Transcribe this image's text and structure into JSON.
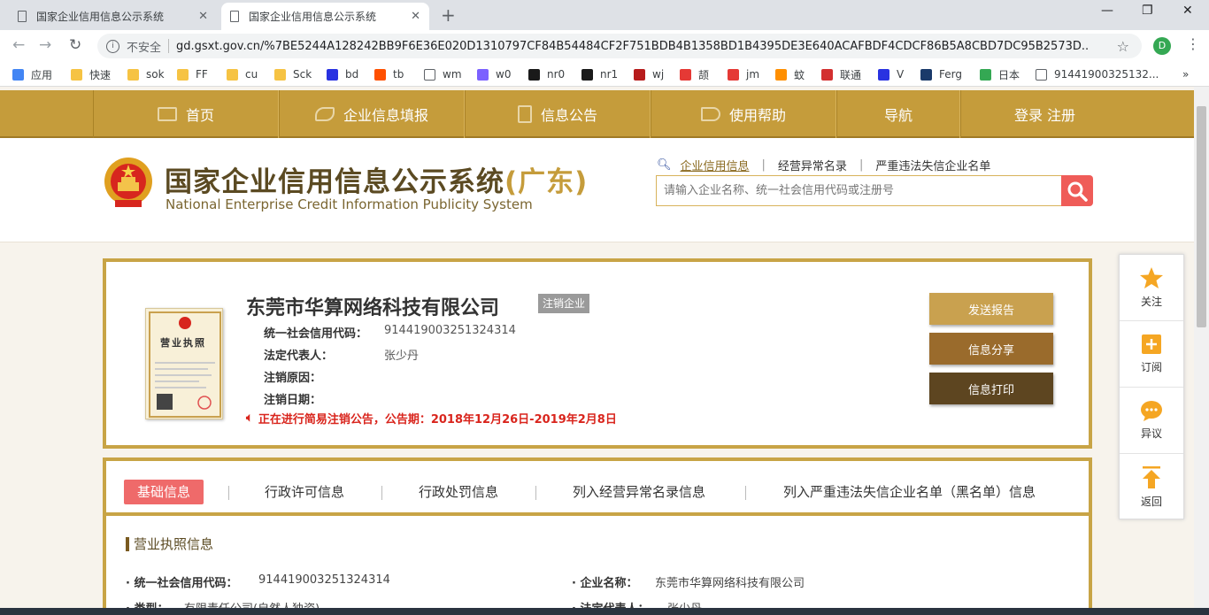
{
  "browser": {
    "tabs": [
      {
        "title": "国家企业信用信息公示系统",
        "close": "✕"
      },
      {
        "title": "国家企业信用信息公示系统",
        "close": "✕"
      }
    ],
    "new_tab": "+",
    "window_controls": {
      "minimize": "—",
      "restore": "❐",
      "close": "✕"
    },
    "nav": {
      "back": "←",
      "forward": "→",
      "reload": "↻"
    },
    "security_label": "不安全",
    "url": "gd.gsxt.gov.cn/%7BE5244A128242BB9F6E36E020D1310797CF84B54484CF2F751BDB4B1358BD1B4395DE3E640ACAFBDF4CDCF86B5A8CBD7DC95B2573D...",
    "profile_initial": "D",
    "bookmarks": [
      {
        "label": "应用",
        "color": "#4285f4"
      },
      {
        "label": "快速",
        "color": "#f6c343"
      },
      {
        "label": "sok",
        "color": "#f6c343"
      },
      {
        "label": "FF",
        "color": "#f6c343"
      },
      {
        "label": "cu",
        "color": "#f6c343"
      },
      {
        "label": "Sck",
        "color": "#f6c343"
      },
      {
        "label": "bd",
        "color": "#2932e1"
      },
      {
        "label": "tb",
        "color": "#ff5000"
      },
      {
        "label": "wm",
        "color": "#ffffff"
      },
      {
        "label": "w0",
        "color": "#7b61ff"
      },
      {
        "label": "nr0",
        "color": "#1a1a1a"
      },
      {
        "label": "nr1",
        "color": "#1a1a1a"
      },
      {
        "label": "wj",
        "color": "#b71c1c"
      },
      {
        "label": "颉",
        "color": "#e53935"
      },
      {
        "label": "jm",
        "color": "#e53935"
      },
      {
        "label": "蚊",
        "color": "#ff8f00"
      },
      {
        "label": "联通",
        "color": "#d32f2f"
      },
      {
        "label": "V",
        "color": "#2932e1"
      },
      {
        "label": "Ferg",
        "color": "#1a3a6a"
      },
      {
        "label": "日本",
        "color": "#34a853"
      },
      {
        "label": "91441900325132...",
        "color": "#ffffff"
      }
    ],
    "more_bookmarks": "»"
  },
  "site_nav": [
    {
      "label": "首页"
    },
    {
      "label": "企业信息填报"
    },
    {
      "label": "信息公告"
    },
    {
      "label": "使用帮助"
    },
    {
      "label": "导航"
    },
    {
      "label": "登录  注册"
    }
  ],
  "header": {
    "title": "国家企业信用信息公示系统",
    "region": "(广东)",
    "title_en": "National Enterprise Credit Information Publicity System",
    "search_tabs": [
      "企业信用信息",
      "经营异常名录",
      "严重违法失信企业名单"
    ],
    "search_placeholder": "请输入企业名称、统一社会信用代码或注册号"
  },
  "company": {
    "name": "东莞市华算网络科技有限公司",
    "status_badge": "注销企业",
    "license_title": "营业执照",
    "fields": [
      {
        "key": "统一社会信用代码：",
        "value": "914419003251324314"
      },
      {
        "key": "法定代表人：",
        "value": "张少丹"
      },
      {
        "key": "注销原因：",
        "value": ""
      },
      {
        "key": "注销日期：",
        "value": ""
      }
    ],
    "notice": "正在进行简易注销公告，公告期：2018年12月26日-2019年2月8日",
    "actions": [
      "发送报告",
      "信息分享",
      "信息打印"
    ]
  },
  "side_float": [
    {
      "label": "关注"
    },
    {
      "label": "订阅"
    },
    {
      "label": "异议"
    },
    {
      "label": "返回"
    }
  ],
  "info": {
    "tabs": [
      "基础信息",
      "行政许可信息",
      "行政处罚信息",
      "列入经营异常名录信息",
      "列入严重违法失信企业名单（黑名单）信息"
    ],
    "section_title": "营业执照信息",
    "rows": [
      {
        "key": "· 统一社会信用代码：",
        "value": "914419003251324314"
      },
      {
        "key": "· 企业名称：",
        "value": "东莞市华算网络科技有限公司"
      },
      {
        "key": "· 类型：",
        "value": "有限责任公司(自然人独资)"
      },
      {
        "key": "· 法定代表人：",
        "value": "张少丹"
      }
    ]
  },
  "colors": {
    "nav_gold": "#c59c3b",
    "card_border": "#c8a446",
    "notice_red": "#d9251d",
    "active_tab": "#ef6a6a",
    "btn_send": "#c9a14f",
    "btn_share": "#9a6b2c",
    "btn_print": "#5d4520"
  }
}
